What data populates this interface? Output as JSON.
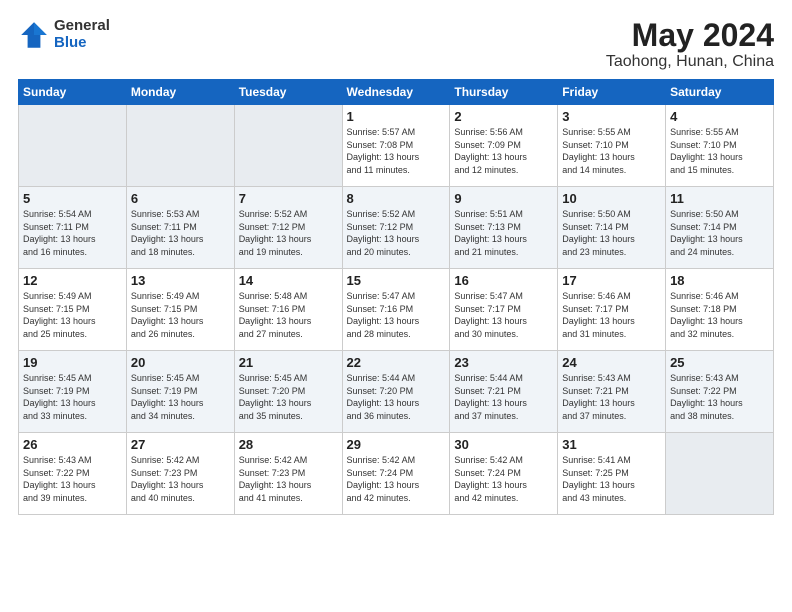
{
  "logo": {
    "general": "General",
    "blue": "Blue"
  },
  "title": "May 2024",
  "location": "Taohong, Hunan, China",
  "days_of_week": [
    "Sunday",
    "Monday",
    "Tuesday",
    "Wednesday",
    "Thursday",
    "Friday",
    "Saturday"
  ],
  "weeks": [
    [
      {
        "day": "",
        "info": ""
      },
      {
        "day": "",
        "info": ""
      },
      {
        "day": "",
        "info": ""
      },
      {
        "day": "1",
        "info": "Sunrise: 5:57 AM\nSunset: 7:08 PM\nDaylight: 13 hours\nand 11 minutes."
      },
      {
        "day": "2",
        "info": "Sunrise: 5:56 AM\nSunset: 7:09 PM\nDaylight: 13 hours\nand 12 minutes."
      },
      {
        "day": "3",
        "info": "Sunrise: 5:55 AM\nSunset: 7:10 PM\nDaylight: 13 hours\nand 14 minutes."
      },
      {
        "day": "4",
        "info": "Sunrise: 5:55 AM\nSunset: 7:10 PM\nDaylight: 13 hours\nand 15 minutes."
      }
    ],
    [
      {
        "day": "5",
        "info": "Sunrise: 5:54 AM\nSunset: 7:11 PM\nDaylight: 13 hours\nand 16 minutes."
      },
      {
        "day": "6",
        "info": "Sunrise: 5:53 AM\nSunset: 7:11 PM\nDaylight: 13 hours\nand 18 minutes."
      },
      {
        "day": "7",
        "info": "Sunrise: 5:52 AM\nSunset: 7:12 PM\nDaylight: 13 hours\nand 19 minutes."
      },
      {
        "day": "8",
        "info": "Sunrise: 5:52 AM\nSunset: 7:12 PM\nDaylight: 13 hours\nand 20 minutes."
      },
      {
        "day": "9",
        "info": "Sunrise: 5:51 AM\nSunset: 7:13 PM\nDaylight: 13 hours\nand 21 minutes."
      },
      {
        "day": "10",
        "info": "Sunrise: 5:50 AM\nSunset: 7:14 PM\nDaylight: 13 hours\nand 23 minutes."
      },
      {
        "day": "11",
        "info": "Sunrise: 5:50 AM\nSunset: 7:14 PM\nDaylight: 13 hours\nand 24 minutes."
      }
    ],
    [
      {
        "day": "12",
        "info": "Sunrise: 5:49 AM\nSunset: 7:15 PM\nDaylight: 13 hours\nand 25 minutes."
      },
      {
        "day": "13",
        "info": "Sunrise: 5:49 AM\nSunset: 7:15 PM\nDaylight: 13 hours\nand 26 minutes."
      },
      {
        "day": "14",
        "info": "Sunrise: 5:48 AM\nSunset: 7:16 PM\nDaylight: 13 hours\nand 27 minutes."
      },
      {
        "day": "15",
        "info": "Sunrise: 5:47 AM\nSunset: 7:16 PM\nDaylight: 13 hours\nand 28 minutes."
      },
      {
        "day": "16",
        "info": "Sunrise: 5:47 AM\nSunset: 7:17 PM\nDaylight: 13 hours\nand 30 minutes."
      },
      {
        "day": "17",
        "info": "Sunrise: 5:46 AM\nSunset: 7:17 PM\nDaylight: 13 hours\nand 31 minutes."
      },
      {
        "day": "18",
        "info": "Sunrise: 5:46 AM\nSunset: 7:18 PM\nDaylight: 13 hours\nand 32 minutes."
      }
    ],
    [
      {
        "day": "19",
        "info": "Sunrise: 5:45 AM\nSunset: 7:19 PM\nDaylight: 13 hours\nand 33 minutes."
      },
      {
        "day": "20",
        "info": "Sunrise: 5:45 AM\nSunset: 7:19 PM\nDaylight: 13 hours\nand 34 minutes."
      },
      {
        "day": "21",
        "info": "Sunrise: 5:45 AM\nSunset: 7:20 PM\nDaylight: 13 hours\nand 35 minutes."
      },
      {
        "day": "22",
        "info": "Sunrise: 5:44 AM\nSunset: 7:20 PM\nDaylight: 13 hours\nand 36 minutes."
      },
      {
        "day": "23",
        "info": "Sunrise: 5:44 AM\nSunset: 7:21 PM\nDaylight: 13 hours\nand 37 minutes."
      },
      {
        "day": "24",
        "info": "Sunrise: 5:43 AM\nSunset: 7:21 PM\nDaylight: 13 hours\nand 37 minutes."
      },
      {
        "day": "25",
        "info": "Sunrise: 5:43 AM\nSunset: 7:22 PM\nDaylight: 13 hours\nand 38 minutes."
      }
    ],
    [
      {
        "day": "26",
        "info": "Sunrise: 5:43 AM\nSunset: 7:22 PM\nDaylight: 13 hours\nand 39 minutes."
      },
      {
        "day": "27",
        "info": "Sunrise: 5:42 AM\nSunset: 7:23 PM\nDaylight: 13 hours\nand 40 minutes."
      },
      {
        "day": "28",
        "info": "Sunrise: 5:42 AM\nSunset: 7:23 PM\nDaylight: 13 hours\nand 41 minutes."
      },
      {
        "day": "29",
        "info": "Sunrise: 5:42 AM\nSunset: 7:24 PM\nDaylight: 13 hours\nand 42 minutes."
      },
      {
        "day": "30",
        "info": "Sunrise: 5:42 AM\nSunset: 7:24 PM\nDaylight: 13 hours\nand 42 minutes."
      },
      {
        "day": "31",
        "info": "Sunrise: 5:41 AM\nSunset: 7:25 PM\nDaylight: 13 hours\nand 43 minutes."
      },
      {
        "day": "",
        "info": ""
      }
    ]
  ]
}
